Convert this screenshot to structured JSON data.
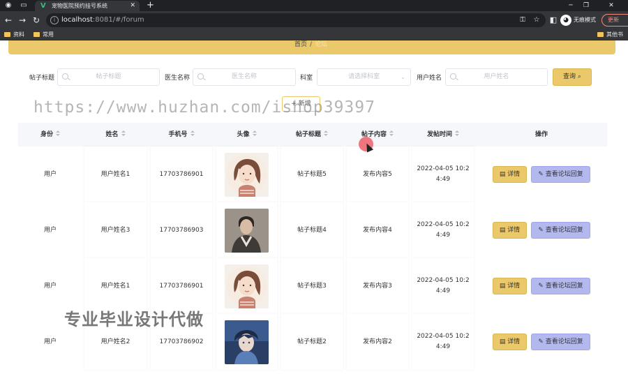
{
  "browser": {
    "tab_title": "宠物医院预约挂号系统",
    "url_host": "localhost",
    "url_rest": ":8081/#/forum",
    "incognito_label": "无痕模式",
    "update_label": "更新",
    "bookmarks": [
      "资料",
      "常用"
    ],
    "bookmark_right": "其他书签"
  },
  "breadcrumb": {
    "home": "首页",
    "separator": "/",
    "current": "论坛"
  },
  "search": {
    "fields": [
      {
        "label": "帖子标题",
        "placeholder": "帖子标题"
      },
      {
        "label": "医生名称",
        "placeholder": "医生名称"
      },
      {
        "label": "科室",
        "placeholder": "请选择科室"
      },
      {
        "label": "用户姓名",
        "placeholder": "用户姓名"
      }
    ],
    "query_label": "查询"
  },
  "add_label": "+ 新增",
  "watermark": "https://www.huzhan.com/ishop39397",
  "watermark2": "专业毕业设计代做",
  "table": {
    "columns": [
      "身份",
      "姓名",
      "手机号",
      "头像",
      "帖子标题",
      "帖子内容",
      "发帖时间",
      "操作"
    ],
    "detail_label": "详情",
    "reply_label": "查看论坛回复",
    "rows": [
      {
        "role": "用户",
        "name": "用户姓名1",
        "phone": "17703786901",
        "avatar": "girl",
        "title": "帖子标题5",
        "content": "发布内容5",
        "time": "2022-04-05 10:24:49"
      },
      {
        "role": "用户",
        "name": "用户姓名3",
        "phone": "17703786903",
        "avatar": "man",
        "title": "帖子标题4",
        "content": "发布内容4",
        "time": "2022-04-05 10:24:49"
      },
      {
        "role": "用户",
        "name": "用户姓名1",
        "phone": "17703786901",
        "avatar": "girl",
        "title": "帖子标题3",
        "content": "发布内容3",
        "time": "2022-04-05 10:24:49"
      },
      {
        "role": "用户",
        "name": "用户姓名2",
        "phone": "17703786902",
        "avatar": "anime-boy",
        "title": "帖子标题2",
        "content": "发布内容2",
        "time": "2022-04-05 10:24:49"
      }
    ]
  }
}
